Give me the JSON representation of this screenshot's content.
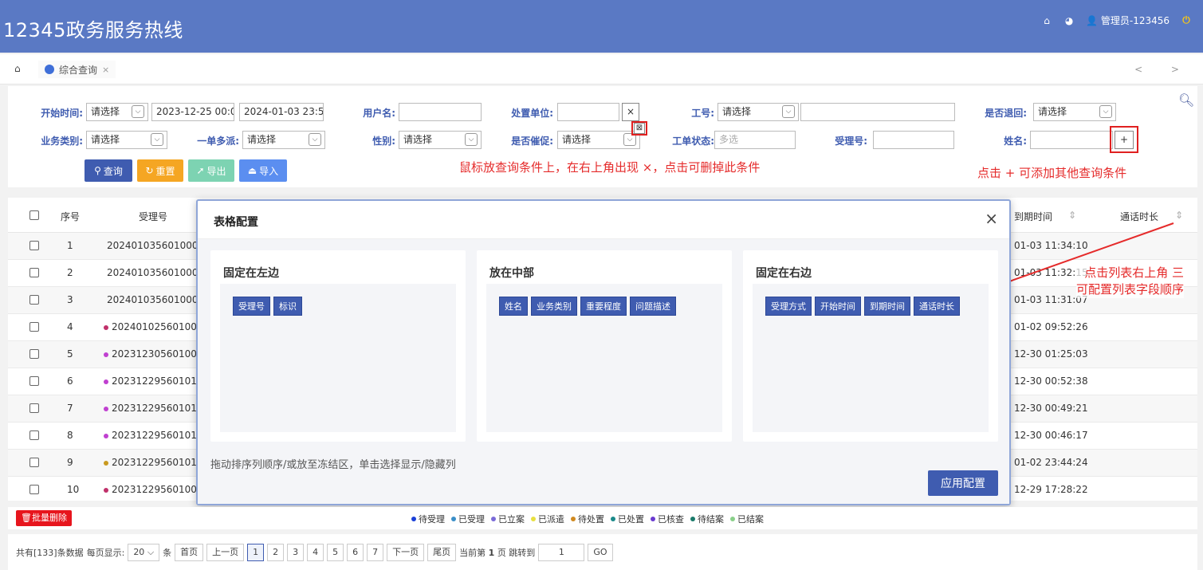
{
  "header": {
    "title": "12345政务服务热线",
    "user": "管理员-123456"
  },
  "tabbar": {
    "tab_label": "综合查询",
    "tab_close": "×",
    "nav_arrows": "< >"
  },
  "search": {
    "start_time_label": "开始时间:",
    "start_time_select": "请选择",
    "start_date": "2023-12-25 00:0(",
    "end_date": "2024-01-03 23:5!",
    "username_label": "用户名:",
    "unit_label": "处置单位:",
    "unit_clear": "×",
    "job_label": "工号:",
    "job_select": "请选择",
    "returned_label": "是否退回:",
    "returned_select": "请选择",
    "biz_label": "业务类别:",
    "biz_select": "请选择",
    "multi_label": "一单多派:",
    "multi_select": "请选择",
    "gender_label": "性别:",
    "gender_select": "请选择",
    "urge_label": "是否催促:",
    "urge_select": "请选择",
    "status_label": "工单状态:",
    "status_placeholder": "多选",
    "accept_no_label": "受理号:",
    "name_label": "姓名:",
    "add_condition": "+",
    "query_button": "查询",
    "reset_button": "重置",
    "export_button": "导出",
    "import_button": "导入",
    "anno_remove": "鼠标放查询条件上，在右上角出现 ×，点击可删掉此条件",
    "anno_add": "点击 + 可添加其他查询条件"
  },
  "table": {
    "col_index": "序号",
    "col_accept_no": "受理号",
    "col_due_time": "到期时间",
    "col_duration": "通话时长",
    "rows": [
      {
        "index": "1",
        "accept_no": "202401035601000",
        "due": "01-03 11:34:10",
        "dot": ""
      },
      {
        "index": "2",
        "accept_no": "202401035601000",
        "due": "01-03 11:32:15",
        "dot": ""
      },
      {
        "index": "3",
        "accept_no": "202401035601000",
        "due": "01-03 11:31:07",
        "dot": ""
      },
      {
        "index": "4",
        "accept_no": "20240102560100",
        "due": "01-02 09:52:26",
        "dot": "#c0306a"
      },
      {
        "index": "5",
        "accept_no": "20231230560100",
        "due": "12-30 01:25:03",
        "dot": "#c040d0"
      },
      {
        "index": "6",
        "accept_no": "20231229560101",
        "due": "12-30 00:52:38",
        "dot": "#c040d0"
      },
      {
        "index": "7",
        "accept_no": "20231229560101",
        "due": "12-30 00:49:21",
        "dot": "#c040d0"
      },
      {
        "index": "8",
        "accept_no": "20231229560101",
        "due": "12-30 00:46:17",
        "dot": "#c040d0"
      },
      {
        "index": "9",
        "accept_no": "20231229560101",
        "due": "01-02 23:44:24",
        "dot": "#c99a20"
      },
      {
        "index": "10",
        "accept_no": "20231229560100",
        "due": "12-29 17:28:22",
        "dot": "#c0306a"
      }
    ],
    "anno_columns": "点击列表右上角 三\n可配置列表字段顺序"
  },
  "modal": {
    "title": "表格配置",
    "close": "×",
    "left_title": "固定在左边",
    "left_chips": [
      "受理号",
      "标识"
    ],
    "middle_title": "放在中部",
    "middle_chips": [
      "姓名",
      "业务类别",
      "重要程度",
      "问题描述"
    ],
    "right_title": "固定在右边",
    "right_chips": [
      "受理方式",
      "开始时间",
      "到期时间",
      "通话时长"
    ],
    "hint": "拖动排序列顺序/或放至冻结区，单击选择显示/隐藏列",
    "apply": "应用配置"
  },
  "legend": {
    "delete_button": "批量删除",
    "items": [
      {
        "label": "待受理",
        "color": "#1a3fd8"
      },
      {
        "label": "已受理",
        "color": "#3a8fc8"
      },
      {
        "label": "已立案",
        "color": "#7a6ad8"
      },
      {
        "label": "已派遣",
        "color": "#e8e040"
      },
      {
        "label": "待处置",
        "color": "#d08a20"
      },
      {
        "label": "已处置",
        "color": "#1a8a8a"
      },
      {
        "label": "已核查",
        "color": "#6a3ad0"
      },
      {
        "label": "待结案",
        "color": "#1a7a6a"
      },
      {
        "label": "已结案",
        "color": "#8ad08a"
      }
    ]
  },
  "pager": {
    "total": "共有[133]条数据",
    "per_page_label": "每页显示:",
    "per_page": "20",
    "unit": "条",
    "first": "首页",
    "prev": "上一页",
    "pages": [
      "1",
      "2",
      "3",
      "4",
      "5",
      "6",
      "7"
    ],
    "next": "下一页",
    "last": "尾页",
    "current_pre": "当前第",
    "current_page": "1",
    "current_post": "页 跳转到",
    "jump_value": "1",
    "go": "GO"
  }
}
